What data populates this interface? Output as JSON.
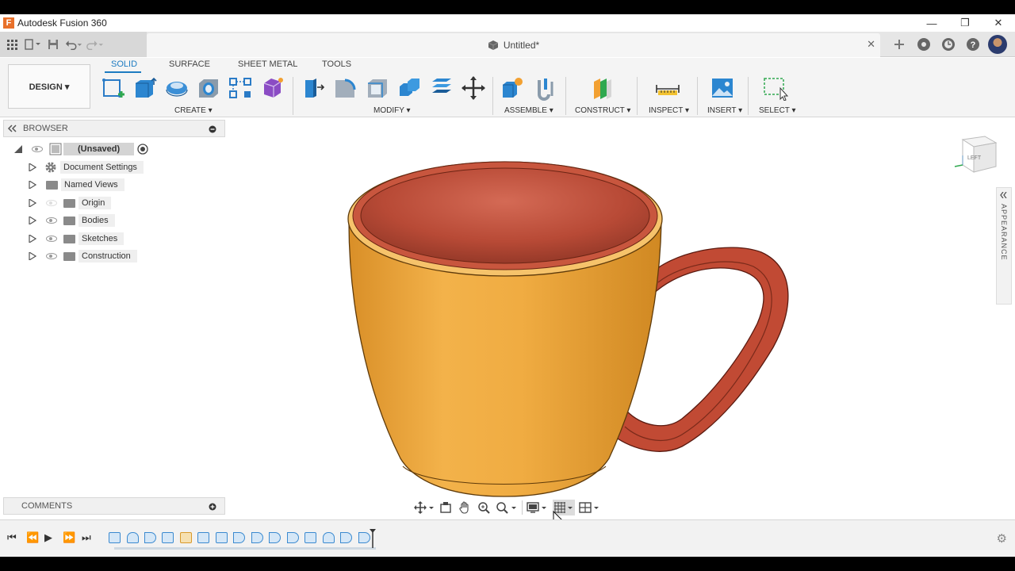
{
  "window": {
    "title": "Autodesk Fusion 360",
    "logo_letter": "F"
  },
  "document": {
    "title": "Untitled*"
  },
  "toolbar": {
    "workspace_button": "DESIGN ▾",
    "tabs": [
      {
        "label": "SOLID",
        "active": true
      },
      {
        "label": "SURFACE",
        "active": false
      },
      {
        "label": "SHEET METAL",
        "active": false
      },
      {
        "label": "TOOLS",
        "active": false
      }
    ],
    "groups": [
      {
        "label": "CREATE ▾"
      },
      {
        "label": "MODIFY ▾"
      },
      {
        "label": "ASSEMBLE ▾"
      },
      {
        "label": "CONSTRUCT ▾"
      },
      {
        "label": "INSPECT ▾"
      },
      {
        "label": "INSERT ▾"
      },
      {
        "label": "SELECT ▾"
      }
    ]
  },
  "browser": {
    "title": "BROWSER",
    "root": "(Unsaved)",
    "items": [
      {
        "label": "Document Settings"
      },
      {
        "label": "Named Views"
      },
      {
        "label": "Origin"
      },
      {
        "label": "Bodies"
      },
      {
        "label": "Sketches"
      },
      {
        "label": "Construction"
      }
    ]
  },
  "comments": {
    "title": "COMMENTS"
  },
  "viewcube": {
    "face": "LEFT"
  },
  "appearance_panel": {
    "label": "APPEARANCE"
  },
  "colors": {
    "accent": "#1d7bc1",
    "mug_body": "#eda43a",
    "mug_inner": "#b84a36",
    "handle": "#c14a34"
  }
}
